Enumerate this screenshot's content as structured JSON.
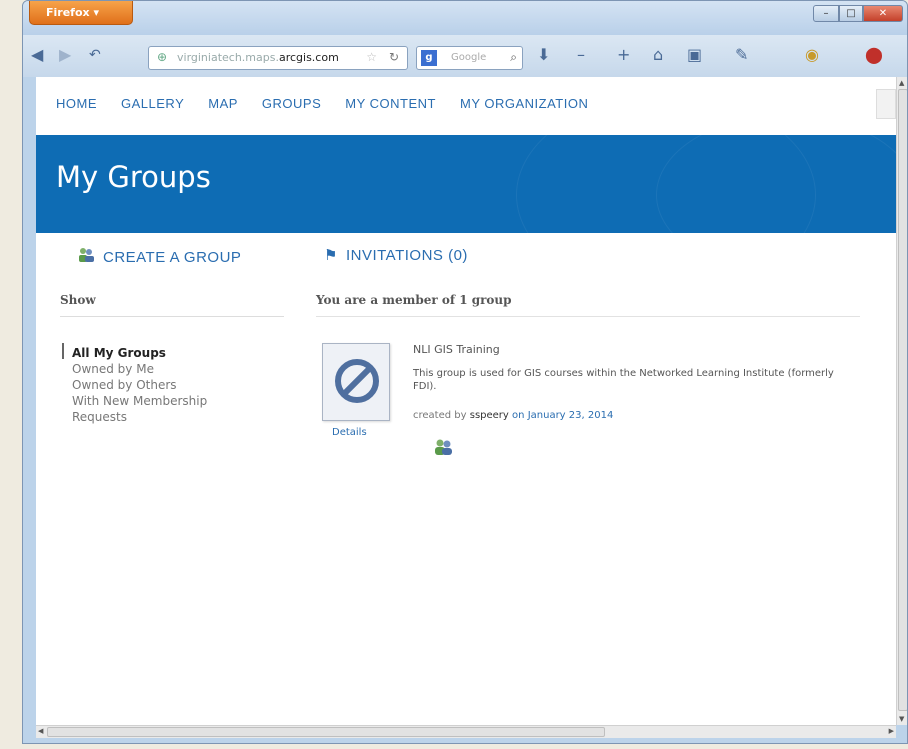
{
  "browser": {
    "app_button": "Firefox",
    "url_prefix": "virginiatech.maps.",
    "url_domain": "arcgis.com",
    "search_placeholder": "Google",
    "search_engine_icon": "google-g-icon"
  },
  "nav": {
    "items": [
      "HOME",
      "GALLERY",
      "MAP",
      "GROUPS",
      "MY CONTENT",
      "MY ORGANIZATION"
    ]
  },
  "banner": {
    "title": "My Groups",
    "color": "#0e6cb4"
  },
  "actions": {
    "create": "CREATE A GROUP",
    "invitations": "INVITATIONS (0)"
  },
  "sidebar": {
    "heading": "Show",
    "filters": [
      "All My Groups",
      "Owned by Me",
      "Owned by Others",
      "With New Membership Requests"
    ],
    "active_filter": "All My Groups"
  },
  "main": {
    "heading": "You are a member of 1 group",
    "group": {
      "title": "NLI GIS Training",
      "description": "This group is used for GIS courses within the Networked Learning Institute (formerly FDI).",
      "created_prefix": "created by",
      "owner": "sspeery",
      "on_word": "on",
      "date": "January 23, 2014",
      "details_link": "Details"
    }
  }
}
